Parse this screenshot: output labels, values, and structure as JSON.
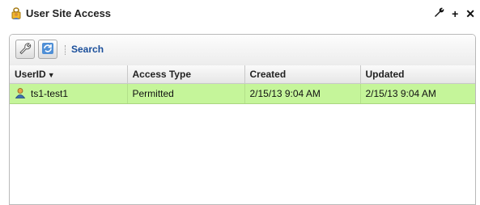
{
  "header": {
    "title": "User Site Access",
    "title_icon": "user-lock-icon",
    "actions": [
      {
        "name": "wrench-icon",
        "glyph": "⚒"
      },
      {
        "name": "plus-icon",
        "glyph": "+"
      },
      {
        "name": "close-icon",
        "glyph": "✕"
      }
    ]
  },
  "toolbar": {
    "settings_icon": "wrench-icon",
    "refresh_icon": "refresh-icon",
    "search_label": "Search"
  },
  "table": {
    "columns": [
      "UserID",
      "Access Type",
      "Created",
      "Updated"
    ],
    "sort_indicator": "▼",
    "rows": [
      {
        "user_id": "ts1-test1",
        "access_type": "Permitted",
        "created": "2/15/13 9:04 AM",
        "updated": "2/15/13 9:04 AM"
      }
    ]
  },
  "colors": {
    "row_selected": "#c5f59a",
    "link": "#1a4e9a"
  }
}
